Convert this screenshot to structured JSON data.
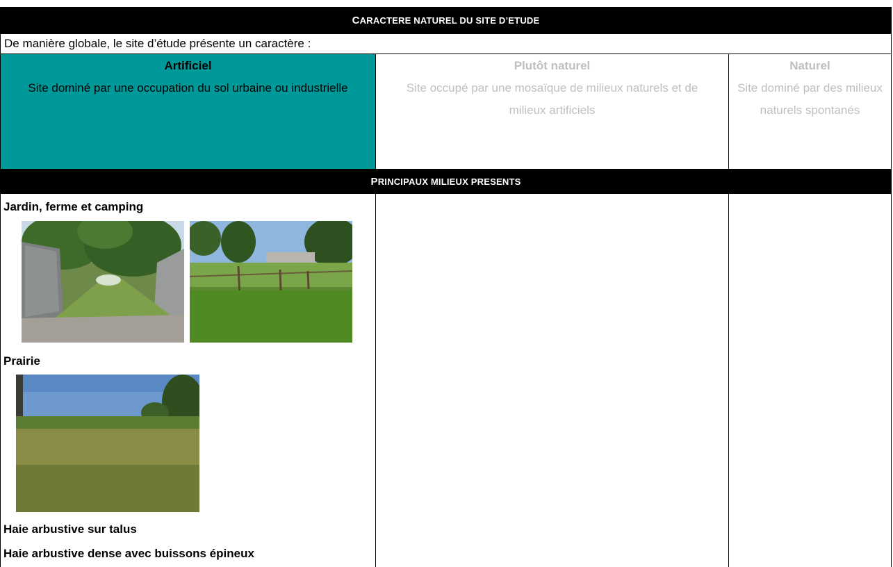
{
  "header": {
    "title_first": "C",
    "title_rest": "ARACTERE NATUREL DU SITE D’ETUDE"
  },
  "intro": "De manière globale, le site d’étude présente un caractère :",
  "options": [
    {
      "title": "Artificiel",
      "desc": "Site dominé par une occupation du sol urbaine ou industrielle",
      "selected": true
    },
    {
      "title": "Plutôt naturel",
      "desc": "Site occupé par une mosaïque de milieux naturels et de milieux artificiels",
      "selected": false
    },
    {
      "title": "Naturel",
      "desc": "Site dominé par des milieux naturels spontanés",
      "selected": false
    }
  ],
  "section2": {
    "title_first": "P",
    "title_rest": "RINCIPAUX MILIEUX PRESENTS"
  },
  "habitats": [
    {
      "label": "Jardin, ferme et camping",
      "photos": [
        "garden-path-photo",
        "fenced-pasture-photo"
      ]
    },
    {
      "label": "Prairie",
      "photos": [
        "meadow-photo"
      ]
    },
    {
      "label": "Haie arbustive sur talus",
      "photos": []
    },
    {
      "label": "Haie arbustive dense avec buissons épineux",
      "photos": []
    }
  ],
  "colors": {
    "selected_bg": "#009999",
    "header_bg": "#000000",
    "dim_text": "#bfbfbf"
  }
}
